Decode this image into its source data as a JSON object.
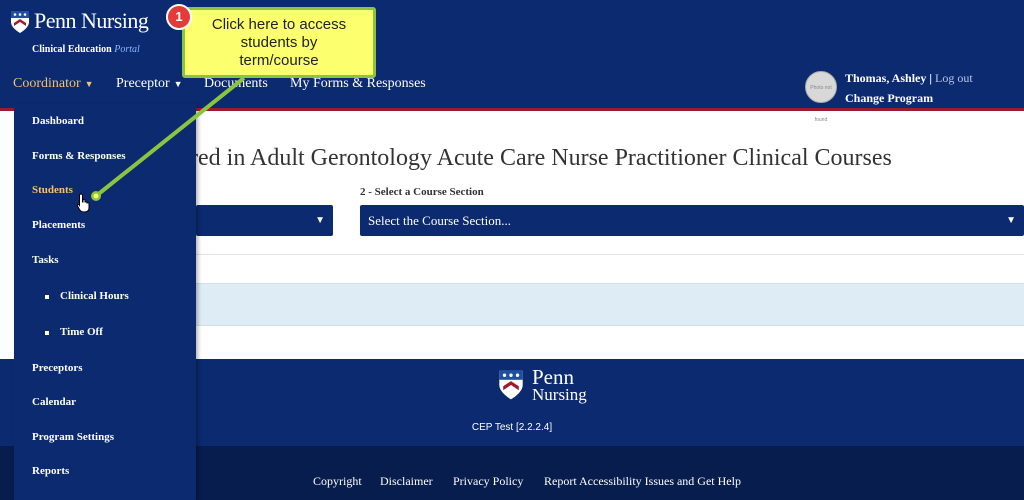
{
  "header": {
    "brand": "Penn Nursing",
    "subtitle_main": "Clinical Education",
    "subtitle_accent": "Portal"
  },
  "nav": {
    "items": [
      {
        "label": "Coordinator",
        "has_caret": true,
        "active": true
      },
      {
        "label": "Preceptor",
        "has_caret": true,
        "active": false
      },
      {
        "label": "Documents",
        "has_caret": false,
        "active": false
      },
      {
        "label": "My Forms & Responses",
        "has_caret": false,
        "active": false
      }
    ]
  },
  "user": {
    "avatar_text": "Photo not found",
    "name": "Thomas, Ashley",
    "separator": "|",
    "logout": "Log out",
    "change_program": "Change Program"
  },
  "main": {
    "title_fragment": "red in Adult Gerontology Acute Care Nurse Practitioner Clinical Courses",
    "course_label": "2 - Select a Course Section",
    "course_placeholder": "Select the Course Section..."
  },
  "dropdown": {
    "items": [
      {
        "label": "Dashboard"
      },
      {
        "label": "Forms & Responses"
      },
      {
        "label": "Students",
        "highlight": true
      },
      {
        "label": "Placements"
      },
      {
        "label": "Tasks"
      },
      {
        "label": "Clinical Hours",
        "sub": true
      },
      {
        "label": "Time Off",
        "sub": true
      },
      {
        "label": "Preceptors"
      },
      {
        "label": "Calendar"
      },
      {
        "label": "Program Settings"
      },
      {
        "label": "Reports"
      }
    ]
  },
  "callout": {
    "number": "1",
    "lines": [
      "Click here to access",
      "students by",
      "term/course"
    ]
  },
  "footer": {
    "logo_word1": "Penn",
    "logo_word2": "Nursing",
    "version": "CEP Test [2.2.2.4]",
    "links": [
      {
        "label": "Copyright"
      },
      {
        "label": "Disclaimer"
      },
      {
        "label": "Privacy Policy"
      },
      {
        "label": "Report Accessibility Issues and Get Help"
      }
    ]
  },
  "colors": {
    "navy": "#0b2a6f",
    "footer_dark": "#061d4d",
    "accent_gold": "#f5c26b",
    "header_border": "#9b1c2e",
    "callout_fill": "#fcff6e",
    "callout_border": "#8bc540",
    "badge_red": "#e43a3a"
  },
  "icons": {
    "logo": "penn-shield-icon",
    "caret": "caret-down-icon",
    "select_arrow": "triangle-down-icon",
    "cursor": "hand-pointer-icon"
  }
}
